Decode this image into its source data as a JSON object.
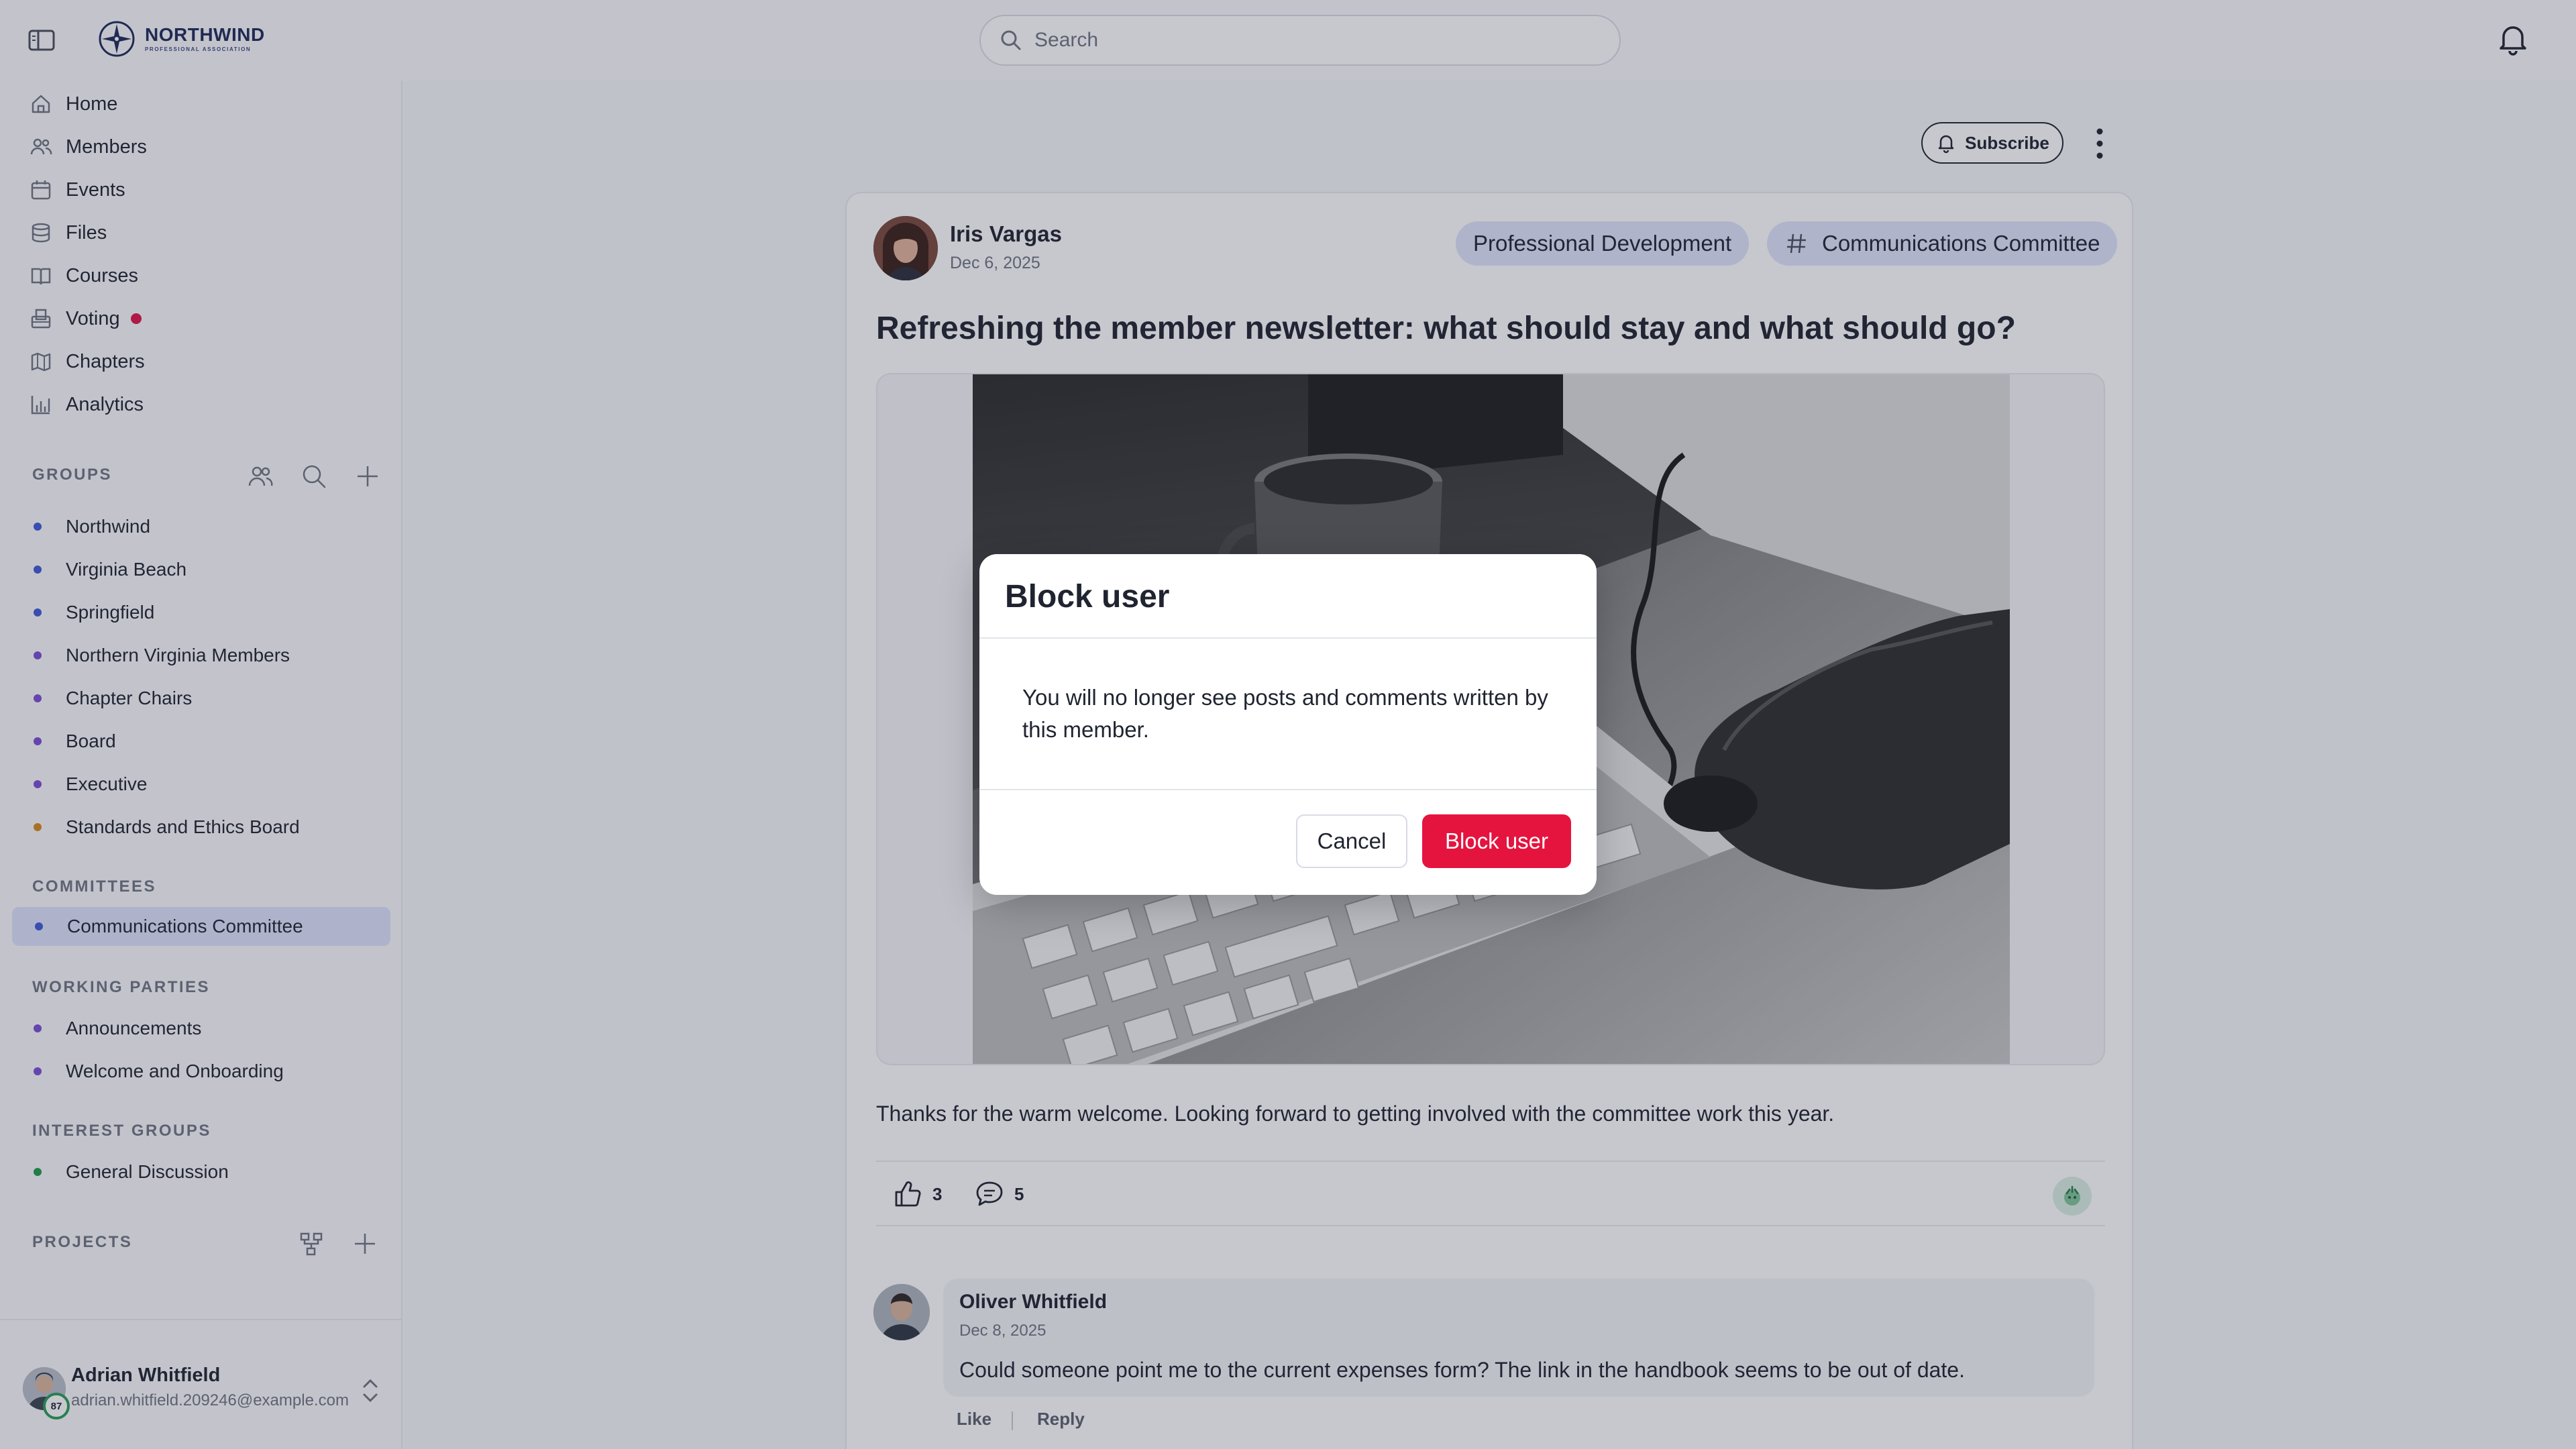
{
  "app": {
    "logo_name": "NORTHWIND",
    "logo_sub": "PROFESSIONAL ASSOCIATION",
    "search_placeholder": "Search"
  },
  "sidebar": {
    "nav": [
      {
        "label": "Home",
        "icon": "home-icon"
      },
      {
        "label": "Members",
        "icon": "members-icon"
      },
      {
        "label": "Events",
        "icon": "calendar-icon"
      },
      {
        "label": "Files",
        "icon": "database-icon"
      },
      {
        "label": "Courses",
        "icon": "book-icon"
      },
      {
        "label": "Voting",
        "icon": "ballot-icon",
        "badge_color": "#e01545"
      },
      {
        "label": "Chapters",
        "icon": "map-icon"
      },
      {
        "label": "Analytics",
        "icon": "chart-icon"
      }
    ],
    "groups_label": "GROUPS",
    "groups": [
      {
        "label": "Northwind",
        "color": "#3f5bd8"
      },
      {
        "label": "Virginia Beach",
        "color": "#3f5bd8"
      },
      {
        "label": "Springfield",
        "color": "#3f5bd8"
      },
      {
        "label": "Northern Virginia Members",
        "color": "#7a4fd6"
      },
      {
        "label": "Chapter Chairs",
        "color": "#7a4fd6"
      },
      {
        "label": "Board",
        "color": "#7a4fd6"
      },
      {
        "label": "Executive",
        "color": "#7a4fd6"
      },
      {
        "label": "Standards and Ethics Board",
        "color": "#d78a1e"
      }
    ],
    "committees_label": "COMMITTEES",
    "committees": [
      {
        "label": "Communications Committee",
        "color": "#3f5bd8",
        "active": true
      }
    ],
    "working_label": "WORKING PARTIES",
    "working": [
      {
        "label": "Announcements",
        "color": "#7a4fd6"
      },
      {
        "label": "Welcome and Onboarding",
        "color": "#7a4fd6"
      }
    ],
    "interest_label": "INTEREST GROUPS",
    "interest": [
      {
        "label": "General Discussion",
        "color": "#1f9a4a"
      }
    ],
    "projects_label": "PROJECTS",
    "user": {
      "name": "Adrian Whitfield",
      "email": "adrian.whitfield.209246@example.com",
      "badge": "87"
    }
  },
  "main": {
    "subscribe_label": "Subscribe",
    "post": {
      "author": "Iris Vargas",
      "date": "Dec 6, 2025",
      "tags": [
        {
          "label": "Professional Development"
        },
        {
          "label": "Communications Committee",
          "icon": "hash-icon"
        }
      ],
      "title": "Refreshing the member newsletter: what should stay and what should go?",
      "body": "Thanks for the warm welcome. Looking forward to getting involved with the committee work this year.",
      "likes": "3",
      "comments": "5"
    },
    "comment": {
      "author": "Oliver Whitfield",
      "date": "Dec 8, 2025",
      "text": "Could someone point me to the current expenses form? The link in the handbook seems to be out of date.",
      "like_label": "Like",
      "reply_label": "Reply"
    }
  },
  "modal": {
    "title": "Block user",
    "body": "You will no longer see posts and comments written by this member.",
    "cancel_label": "Cancel",
    "confirm_label": "Block user",
    "confirm_color": "#e5143f"
  }
}
